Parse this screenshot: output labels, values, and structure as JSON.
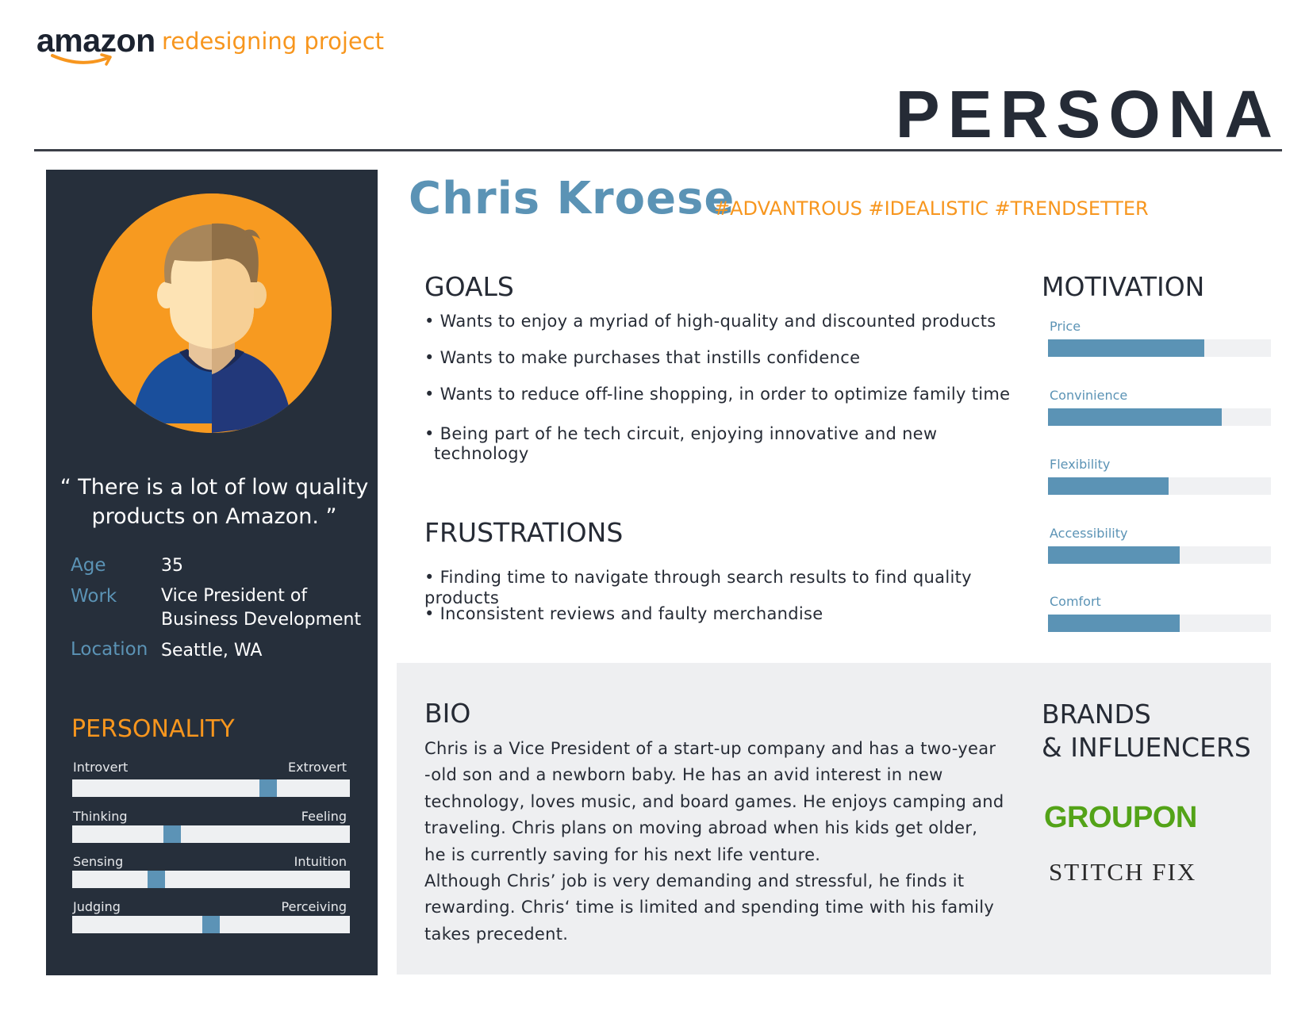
{
  "header": {
    "brand": "amazon",
    "project": "redesigning project",
    "title": "PERSONA"
  },
  "persona": {
    "name": "Chris Kroese",
    "tags": "#ADVANTROUS #IDEALISTIC #TRENDSETTER",
    "quote_line1": "“ There is a lot of low quality",
    "quote_line2": "products on Amazon. ”",
    "info": {
      "age_label": "Age",
      "age_value": "35",
      "work_label": "Work",
      "work_value_line1": "Vice President of",
      "work_value_line2": "Business Development",
      "location_label": "Location",
      "location_value": "Seattle, WA"
    }
  },
  "personality": {
    "title": "PERSONALITY",
    "traits": [
      {
        "left": "Introvert",
        "right": "Extrovert",
        "value": 0.72
      },
      {
        "left": "Thinking",
        "right": "Feeling",
        "value": 0.35
      },
      {
        "left": "Sensing",
        "right": "Intuition",
        "value": 0.29
      },
      {
        "left": "Judging",
        "right": "Perceiving",
        "value": 0.5
      }
    ]
  },
  "goals": {
    "title": "GOALS",
    "items": [
      "• Wants to enjoy a myriad of high-quality and discounted products",
      "• Wants to make purchases that instills confidence",
      "• Wants to reduce off-line shopping, in order to optimize family time",
      "• Being part of he tech circuit, enjoying innovative and new",
      "technology"
    ]
  },
  "frustrations": {
    "title": "FRUSTRATIONS",
    "items": [
      "• Finding time to navigate through search results to find quality products",
      "• Inconsistent reviews and faulty merchandise"
    ]
  },
  "motivation": {
    "title": "MOTIVATION",
    "items": [
      {
        "label": "Price",
        "value": 0.7
      },
      {
        "label": "Convinience",
        "value": 0.78
      },
      {
        "label": "Flexibility",
        "value": 0.54
      },
      {
        "label": "Accessibility",
        "value": 0.59
      },
      {
        "label": "Comfort",
        "value": 0.59
      }
    ]
  },
  "bio": {
    "title": "BIO",
    "lines": [
      "Chris is a Vice President of a start-up company and has a two-year",
      "-old son and a newborn baby. He has an avid interest in new",
      "technology, loves music, and board games. He enjoys camping and",
      "traveling. Chris plans on moving abroad when his kids get older,",
      "he is currently saving for his next life venture.",
      "Although Chris’ job is very demanding and stressful, he finds it",
      "rewarding. Chris‘ time is limited and spending time with his family",
      "takes precedent."
    ]
  },
  "brands": {
    "title_line1": "BRANDS",
    "title_line2": "& INFLUENCERS",
    "groupon": "GROUPON",
    "stitchfix": "STITCH FIX"
  },
  "colors": {
    "accent_orange": "#f7961e",
    "accent_blue": "#5b93b5",
    "sidebar_bg": "#262f3b",
    "groupon_green": "#53a318"
  }
}
